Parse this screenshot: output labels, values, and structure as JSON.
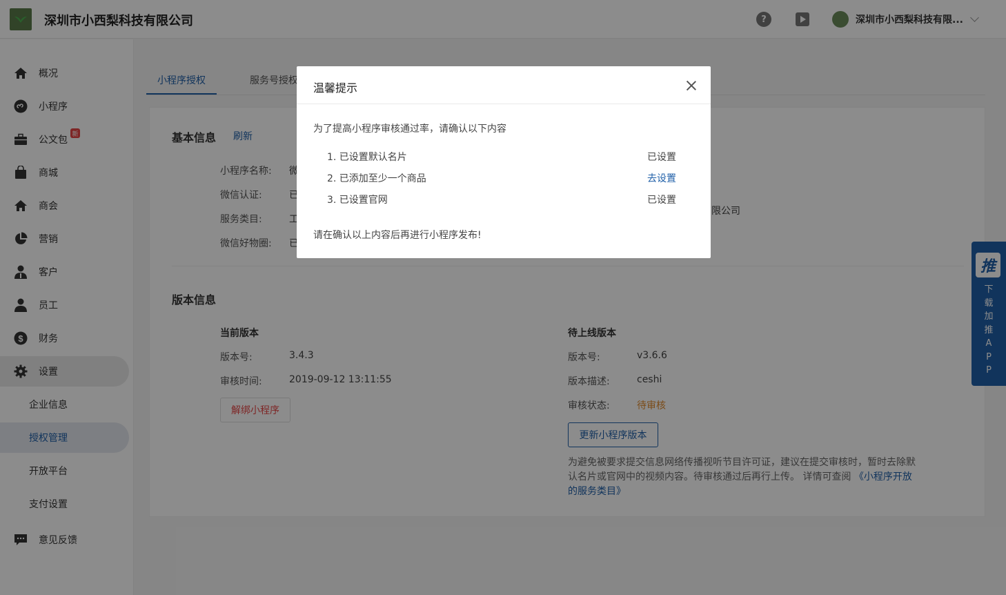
{
  "header": {
    "company": "深圳市小西梨科技有限公司",
    "help_icon": "?",
    "user_name": "深圳市小西梨科技有限..."
  },
  "sidebar": {
    "items": [
      {
        "label": "概况",
        "icon": "home-icon"
      },
      {
        "label": "小程序",
        "icon": "mini-program-icon"
      },
      {
        "label": "公文包",
        "icon": "briefcase-icon",
        "badge": "新"
      },
      {
        "label": "商城",
        "icon": "shopping-bag-icon"
      },
      {
        "label": "商会",
        "icon": "home-icon"
      },
      {
        "label": "营销",
        "icon": "pie-chart-icon"
      },
      {
        "label": "客户",
        "icon": "customer-icon"
      },
      {
        "label": "员工",
        "icon": "user-icon"
      },
      {
        "label": "财务",
        "icon": "dollar-icon"
      },
      {
        "label": "设置",
        "icon": "gear-icon"
      }
    ],
    "sub_items": [
      {
        "label": "企业信息"
      },
      {
        "label": "授权管理"
      },
      {
        "label": "开放平台"
      },
      {
        "label": "支付设置"
      }
    ],
    "feedback": {
      "label": "意见反馈",
      "icon": "feedback-icon"
    }
  },
  "tabs": [
    {
      "label": "小程序授权"
    },
    {
      "label": "服务号授权"
    }
  ],
  "basic_info": {
    "title": "基本信息",
    "refresh": "刷新",
    "rows": [
      {
        "label": "小程序名称:",
        "value": "微"
      },
      {
        "label": "微信认证:",
        "value": "已"
      },
      {
        "label": "服务类目:",
        "value": "工"
      },
      {
        "label": "微信好物圈:",
        "value": "已"
      }
    ],
    "right_value": "有限公司"
  },
  "version_info": {
    "title": "版本信息",
    "current": {
      "title": "当前版本",
      "version_label": "版本号:",
      "version": "3.4.3",
      "time_label": "审核时间:",
      "time": "2019-09-12 13:11:55",
      "unbind_button": "解绑小程序"
    },
    "pending": {
      "title": "待上线版本",
      "version_label": "版本号:",
      "version": "v3.6.6",
      "desc_label": "版本描述:",
      "desc": "ceshi",
      "status_label": "审核状态:",
      "status": "待审核",
      "update_button": "更新小程序版本",
      "note": "为避免被要求提交信息网络传播视听节目许可证，建议在提交审核时，暂时去除默认名片或官网中的视频内容。待审核通过后再行上传。 详情可查阅",
      "note_link": "《小程序开放的服务类目》"
    }
  },
  "float_app": {
    "logo": "推",
    "text": [
      "下",
      "载",
      "加",
      "推",
      "A",
      "P",
      "P"
    ]
  },
  "modal": {
    "title": "温馨提示",
    "intro": "为了提高小程序审核通过率，请确认以下内容",
    "checks": [
      {
        "label": "1. 已设置默认名片",
        "status": "已设置"
      },
      {
        "label": "2. 已添加至少一个商品",
        "status": "去设置"
      },
      {
        "label": "3. 已设置官网",
        "status": "已设置"
      }
    ],
    "footer": "请在确认以上内容后再进行小程序发布!"
  },
  "colors": {
    "accent": "#1f5fa8",
    "danger": "#e64545",
    "warning": "#e08a2c"
  }
}
